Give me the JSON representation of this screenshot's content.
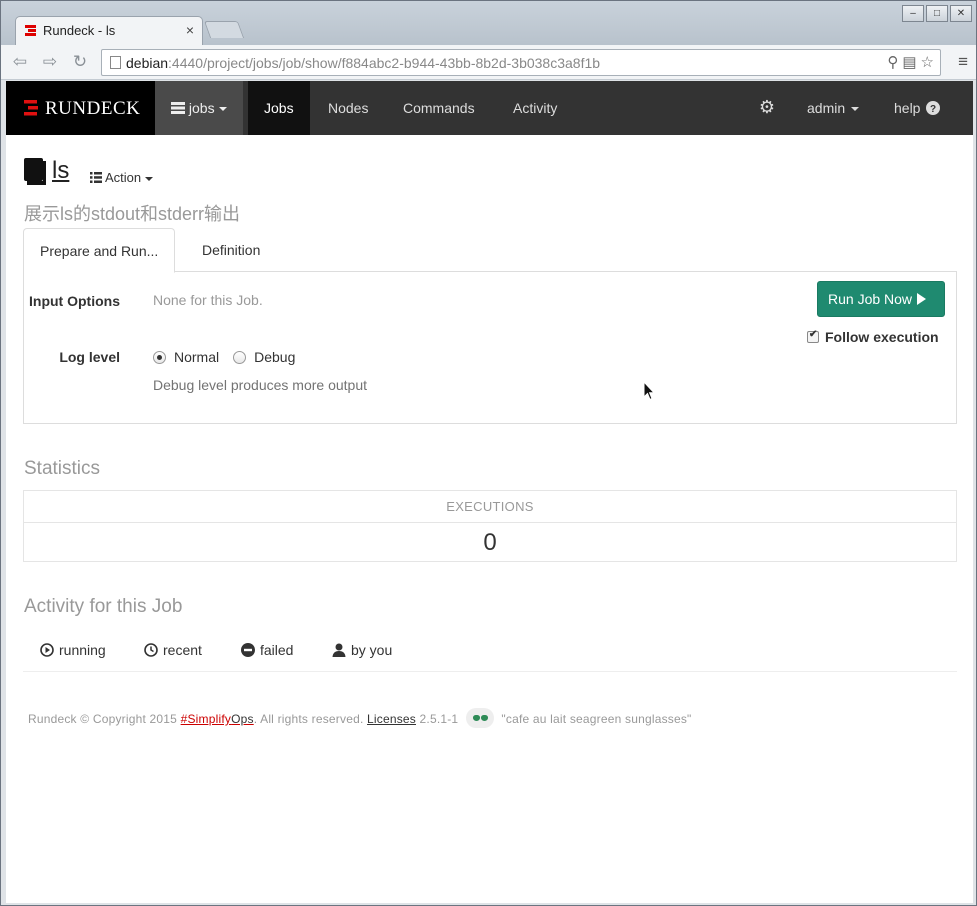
{
  "browser": {
    "tab_title": "Rundeck - ls",
    "tab_close": "×",
    "url_host": "debian",
    "url_rest": ":4440/project/jobs/job/show/f884abc2-b944-43bb-8b2d-3b038c3a8f1b",
    "window_buttons": [
      "–",
      "□",
      "✕"
    ]
  },
  "navbar": {
    "brand": "RUNDECK",
    "project": "jobs",
    "items": [
      "Jobs",
      "Nodes",
      "Commands",
      "Activity"
    ],
    "active_item": "Jobs",
    "user": "admin",
    "help": "help"
  },
  "job": {
    "name": "ls",
    "action_label": "Action",
    "description": "展示ls的stdout和stderr输出"
  },
  "tabs": {
    "run": "Prepare and Run...",
    "definition": "Definition"
  },
  "run_panel": {
    "input_options_label": "Input Options",
    "input_options_value": "None for this Job.",
    "log_level_label": "Log level",
    "log_level_options": [
      "Normal",
      "Debug"
    ],
    "log_level_selected": "Normal",
    "log_level_help": "Debug level produces more output",
    "run_button": "Run Job Now",
    "follow_label": "Follow execution",
    "follow_checked": true
  },
  "statistics": {
    "heading": "Statistics",
    "column": "EXECUTIONS",
    "value": "0"
  },
  "activity": {
    "heading": "Activity for this Job",
    "tabs": [
      "running",
      "recent",
      "failed",
      "by you"
    ]
  },
  "footer": {
    "copyright": "Rundeck © Copyright 2015",
    "simplify": "#Simplify",
    "ops": "Ops",
    "rights": ". All rights reserved.",
    "licenses": "Licenses",
    "version": "2.5.1-1",
    "codename": "\"cafe au lait seagreen sunglasses\""
  },
  "colors": {
    "navbar_bg": "#333333",
    "brand_bg": "#000000",
    "run_button": "#1f8a70",
    "brand_red": "#cc0000"
  }
}
